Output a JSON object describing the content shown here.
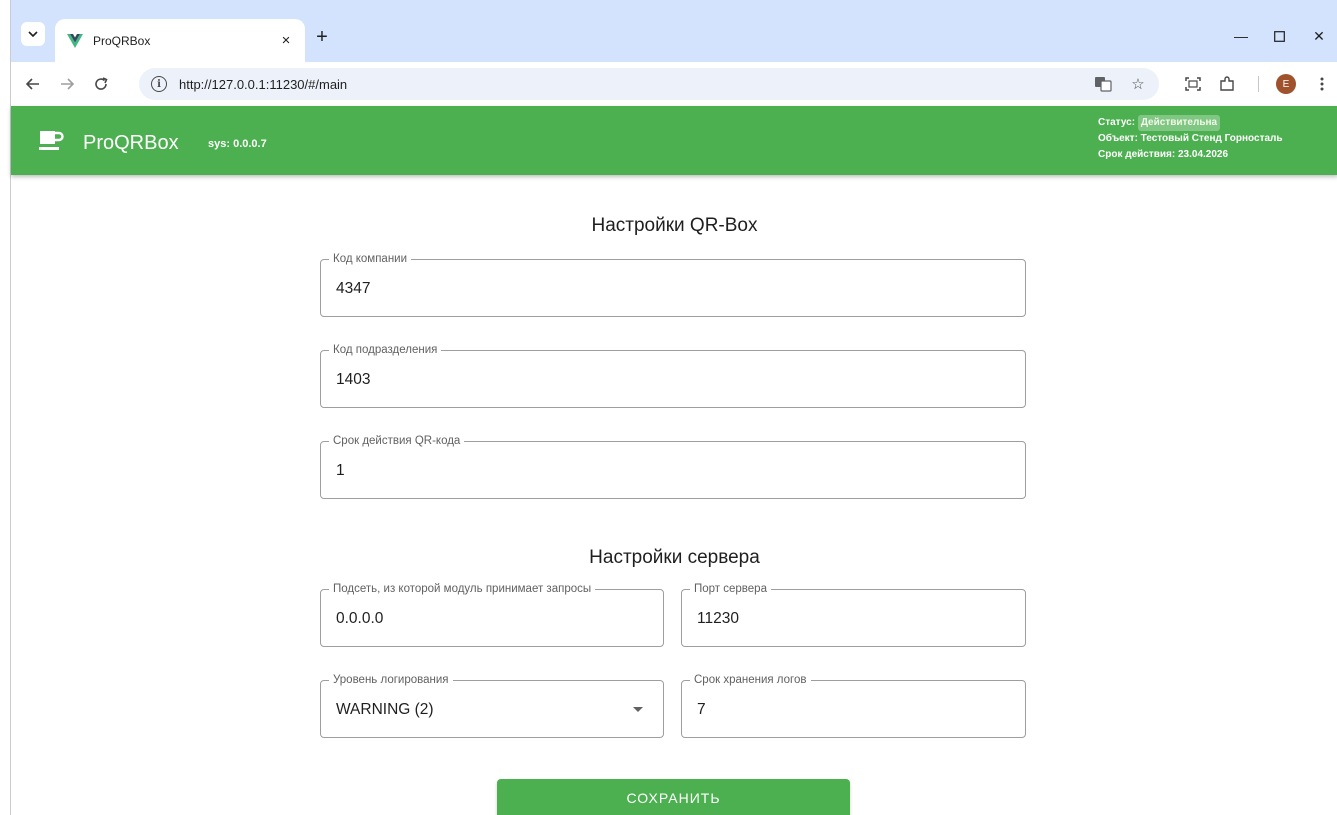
{
  "browser": {
    "tab_title": "ProQRBox",
    "tab_close": "×",
    "new_tab": "+",
    "url": "http://127.0.0.1:11230/#/main",
    "avatar_letter": "E",
    "minimize": "—",
    "close": "✕"
  },
  "app": {
    "title": "ProQRBox",
    "version": "sys: 0.0.0.7",
    "status_label": "Статус:",
    "status_value": "Действительна",
    "object_line": "Объект: Тестовый Стенд Горносталь",
    "expiry_line": "Срок действия: 23.04.2026",
    "brand_color": "#4caf50"
  },
  "qrbox": {
    "title": "Настройки QR-Box",
    "company_code": {
      "label": "Код компании",
      "value": "4347"
    },
    "division_code": {
      "label": "Код подразделения",
      "value": "1403"
    },
    "qr_validity": {
      "label": "Срок действия QR-кода",
      "value": "1"
    }
  },
  "server": {
    "title": "Настройки сервера",
    "subnet": {
      "label": "Подсеть, из которой модуль принимает запросы",
      "value": "0.0.0.0"
    },
    "port": {
      "label": "Порт сервера",
      "value": "11230"
    },
    "log_level": {
      "label": "Уровень логирования",
      "value": "WARNING (2)"
    },
    "log_retention": {
      "label": "Срок хранения логов",
      "value": "7"
    }
  },
  "actions": {
    "save_label": "СОХРАНИТЬ"
  }
}
